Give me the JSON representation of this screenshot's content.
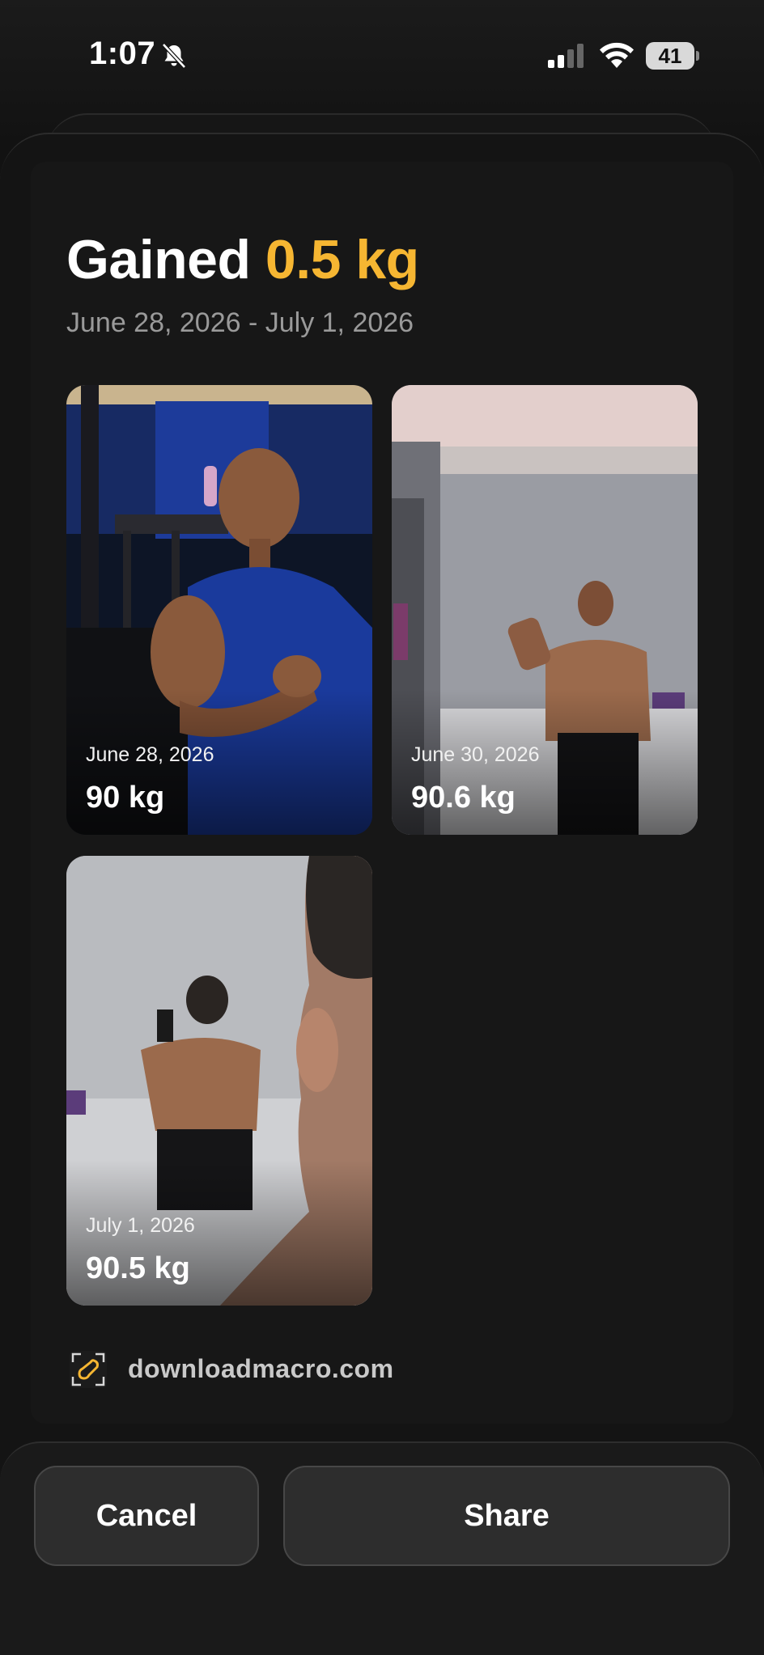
{
  "status_bar": {
    "time": "1:07",
    "battery": "41",
    "icons": [
      "bell-slash-icon",
      "cellular-signal-icon",
      "wifi-icon",
      "battery-icon"
    ]
  },
  "summary": {
    "prefix": "Gained",
    "amount": "0.5 kg",
    "date_range": "June 28, 2026 - July 1, 2026",
    "accent_color": "#f6b632"
  },
  "photos": [
    {
      "date": "June 28, 2026",
      "weight": "90 kg"
    },
    {
      "date": "June 30, 2026",
      "weight": "90.6 kg"
    },
    {
      "date": "July 1, 2026",
      "weight": "90.5 kg"
    }
  ],
  "brand": {
    "icon": "macro-logo-icon",
    "text": "downloadmacro.com"
  },
  "actions": {
    "cancel_label": "Cancel",
    "share_label": "Share"
  }
}
